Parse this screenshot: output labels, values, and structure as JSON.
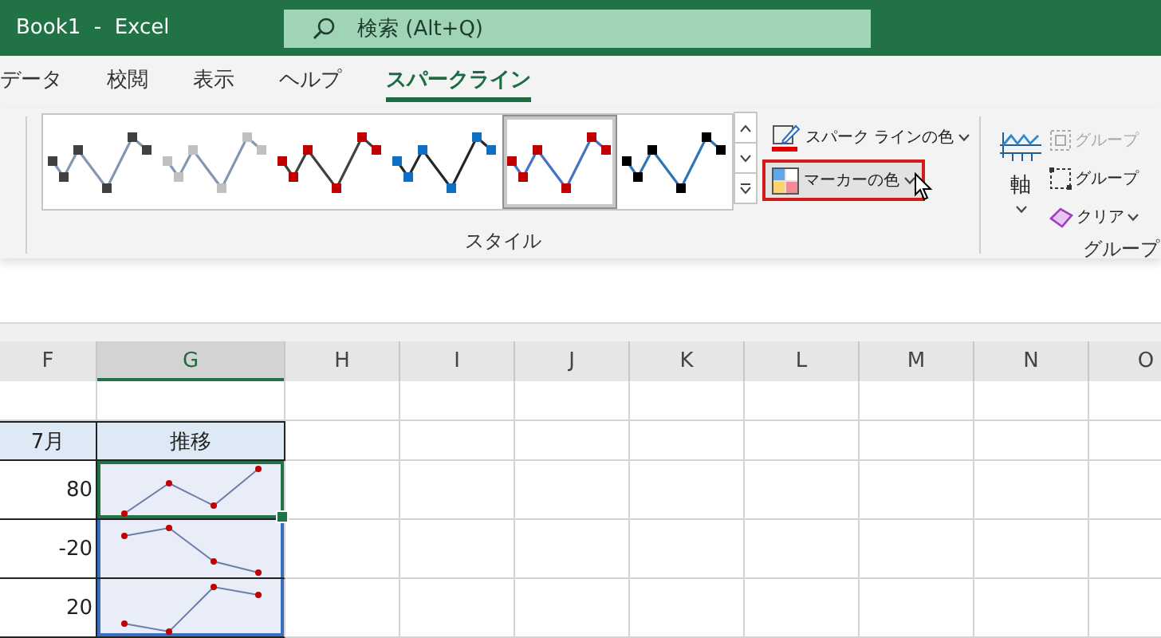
{
  "window": {
    "title": "Book1  -  Excel"
  },
  "search": {
    "placeholder": "検索 (Alt+Q)"
  },
  "tabs": [
    {
      "label": "データ",
      "selected": false
    },
    {
      "label": "校閲",
      "selected": false
    },
    {
      "label": "表示",
      "selected": false
    },
    {
      "label": "ヘルプ",
      "selected": false
    },
    {
      "label": "スパークライン",
      "selected": true
    }
  ],
  "style_group": {
    "label": "スタイル",
    "styles": [
      {
        "selected": false,
        "line": {
          "color": "#8497b0"
        },
        "markers": {
          "color": "#404040"
        }
      },
      {
        "selected": false,
        "line": {
          "color": "#8497b0"
        },
        "markers": {
          "color": "#c0c0c0"
        }
      },
      {
        "selected": false,
        "line": {
          "color": "#404040"
        },
        "markers": {
          "color": "#c00000"
        }
      },
      {
        "selected": false,
        "line": {
          "color": "#262626"
        },
        "markers": {
          "color": "#0f6fc6"
        }
      },
      {
        "selected": true,
        "line": {
          "color": "#4472c4"
        },
        "markers": {
          "color": "#c00000"
        }
      },
      {
        "selected": false,
        "line": {
          "color": "#2e75b6"
        },
        "markers": {
          "color": "#000000"
        }
      }
    ],
    "buttons": [
      {
        "kind": "line-color",
        "label": "スパーク ラインの色",
        "highlighted": false
      },
      {
        "kind": "marker-color",
        "label": "マーカーの色",
        "highlighted": true
      }
    ]
  },
  "group_group": {
    "label": "グループ",
    "axis": {
      "label": "軸"
    },
    "buttons": [
      {
        "kind": "group",
        "label": "グループ",
        "disabled": true
      },
      {
        "kind": "ungroup",
        "label": "グループ",
        "disabled": false
      },
      {
        "kind": "clear",
        "label": "クリア",
        "disabled": false
      }
    ]
  },
  "sheet": {
    "columns": [
      {
        "label": "F",
        "selected": false
      },
      {
        "label": "G",
        "selected": true
      },
      {
        "label": "H",
        "selected": false
      },
      {
        "label": "I",
        "selected": false
      },
      {
        "label": "J",
        "selected": false
      },
      {
        "label": "K",
        "selected": false
      },
      {
        "label": "L",
        "selected": false
      },
      {
        "label": "M",
        "selected": false
      },
      {
        "label": "N",
        "selected": false
      },
      {
        "label": "O",
        "selected": false
      }
    ],
    "rows": [
      {
        "kind": "blank"
      },
      {
        "kind": "header",
        "cells": [
          "7月",
          "推移"
        ]
      },
      {
        "kind": "data",
        "value": "80",
        "active": true
      },
      {
        "kind": "data",
        "value": "-20",
        "active": false
      },
      {
        "kind": "data",
        "value": "20",
        "active": false
      }
    ]
  }
}
